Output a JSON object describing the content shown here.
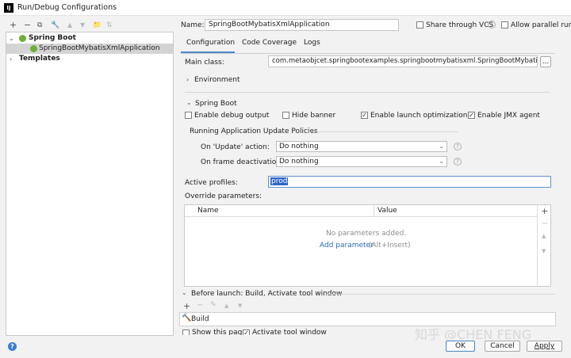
{
  "window": {
    "app_icon": "IJ",
    "title": "Run/Debug Configurations"
  },
  "toolbar": {
    "icons": [
      "+",
      "−",
      "⧉",
      "🔧",
      "▲",
      "▼",
      "📁",
      "⇅"
    ]
  },
  "tree": {
    "spring_boot_label": "Spring Boot",
    "app_label": "SpringBootMybatisXmlApplication",
    "templates_label": "Templates"
  },
  "form": {
    "name_label": "Name:",
    "name_value": "SpringBootMybatisXmlApplication",
    "share_vcs_label": "Share through VCS",
    "allow_parallel_label": "Allow parallel run"
  },
  "tabs": [
    "Configuration",
    "Code Coverage",
    "Logs"
  ],
  "config": {
    "main_class_label": "Main class:",
    "main_class_value": "com.metaobjcet.springbootexamples.springbootmybatisxml.SpringBootMybatisXmlAp",
    "browse_label": "...",
    "environment_label": "Environment",
    "spring_boot_section": "Spring Boot",
    "enable_debug_label": "Enable debug output",
    "hide_banner_label": "Hide banner",
    "enable_launch_opt_label": "Enable launch optimization",
    "enable_jmx_label": "Enable JMX agent",
    "policies_label": "Running Application Update Policies",
    "on_update_label": "On 'Update' action:",
    "on_update_value": "Do nothing",
    "on_frame_label": "On frame deactivation:",
    "on_frame_value": "Do nothing",
    "active_profiles_label": "Active profiles:",
    "active_profiles_value": "prod",
    "override_label": "Override parameters:"
  },
  "params_table": {
    "col_name": "Name",
    "col_value": "Value",
    "empty_text": "No parameters added.",
    "add_link": "Add parameter",
    "add_shortcut": "(Alt+Insert)"
  },
  "before_launch": {
    "label": "Before launch: Build, Activate tool window",
    "build_item": "Build",
    "show_page_label": "Show this page",
    "activate_window_label": "Activate tool window"
  },
  "buttons": {
    "ok": "OK",
    "cancel": "Cancel",
    "apply": "Apply",
    "help": "?"
  },
  "watermark": "知乎 @CHEN FENG"
}
